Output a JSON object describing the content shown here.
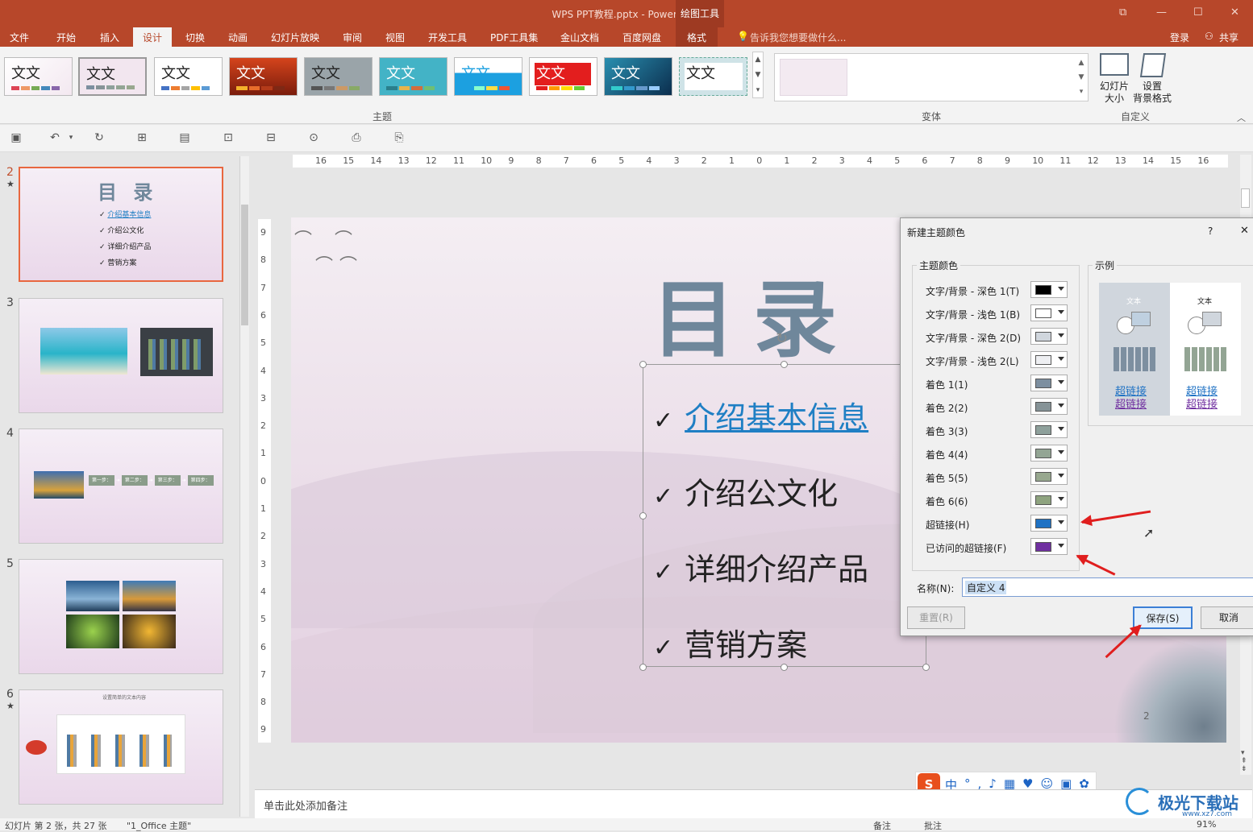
{
  "titlebar": {
    "title": "WPS PPT教程.pptx - PowerPoint",
    "context_tab": "绘图工具",
    "restore": "⧉",
    "minimize": "—",
    "maximize": "☐",
    "close": "✕"
  },
  "tabs": [
    "文件",
    "开始",
    "插入",
    "设计",
    "切换",
    "动画",
    "幻灯片放映",
    "审阅",
    "视图",
    "开发工具",
    "PDF工具集",
    "金山文档",
    "百度网盘",
    "格式"
  ],
  "tell_me": "告诉我您想要做什么...",
  "login": "登录",
  "share": "共享",
  "ribbon": {
    "theme_label": "文文",
    "group_theme": "主题",
    "group_variant": "变体",
    "group_custom": "自定义",
    "slide_size": "幻灯片\n大小",
    "bg_format": "设置\n背景格式"
  },
  "slides": [
    {
      "num": "2",
      "title": "目 录",
      "items": [
        "介绍基本信息",
        "介绍公文化",
        "详细介绍产品",
        "营销方案"
      ]
    },
    {
      "num": "3"
    },
    {
      "num": "4",
      "steps": [
        "第一步：",
        "第二步：",
        "第三步：",
        "第四步："
      ]
    },
    {
      "num": "5"
    },
    {
      "num": "6",
      "heading": "设置简单的文本内容"
    }
  ],
  "ruler_h": [
    "16",
    "15",
    "14",
    "13",
    "12",
    "11",
    "10",
    "9",
    "8",
    "7",
    "6",
    "5",
    "4",
    "3",
    "2",
    "1",
    "0",
    "1",
    "2",
    "3",
    "4",
    "5",
    "6",
    "7",
    "8",
    "9",
    "10",
    "11",
    "12",
    "13",
    "14",
    "15",
    "16"
  ],
  "ruler_v": [
    "9",
    "8",
    "7",
    "6",
    "5",
    "4",
    "3",
    "2",
    "1",
    "0",
    "1",
    "2",
    "3",
    "4",
    "5",
    "6",
    "7",
    "8",
    "9"
  ],
  "slide": {
    "title": "目录",
    "items": [
      "介绍基本信息",
      "介绍公文化",
      "详细介绍产品",
      "营销方案"
    ],
    "check": "✓",
    "page_num": "2"
  },
  "notes": "单击此处添加备注",
  "status": {
    "slide_info": "幻灯片 第 2 张，共 27 张",
    "theme": "\"1_Office 主题\"",
    "notes": "备注",
    "comments": "批注",
    "zoom": "91%"
  },
  "dialog": {
    "title": "新建主题颜色",
    "help": "?",
    "close": "✕",
    "group_colors": "主题颜色",
    "group_sample": "示例",
    "rows": [
      {
        "label": "文字/背景 - 深色 1(T)",
        "color": "#000000"
      },
      {
        "label": "文字/背景 - 浅色 1(B)",
        "color": "#ffffff"
      },
      {
        "label": "文字/背景 - 深色 2(D)",
        "color": "#d0d6dd"
      },
      {
        "label": "文字/背景 - 浅色 2(L)",
        "color": "#eeeff2"
      },
      {
        "label": "着色 1(1)",
        "color": "#7d8fa0"
      },
      {
        "label": "着色 2(2)",
        "color": "#869397"
      },
      {
        "label": "着色 3(3)",
        "color": "#8ea09b"
      },
      {
        "label": "着色 4(4)",
        "color": "#93a594"
      },
      {
        "label": "着色 5(5)",
        "color": "#98a88f"
      },
      {
        "label": "着色 6(6)",
        "color": "#8ea37f"
      },
      {
        "label": "超链接(H)",
        "color": "#1f72c4"
      },
      {
        "label": "已访问的超链接(F)",
        "color": "#7030a0"
      }
    ],
    "sample_text": "文本",
    "sample_link": "超链接",
    "sample_visited": "超链接",
    "name_label": "名称(N):",
    "name_value": "自定义 4",
    "reset": "重置(R)",
    "save": "保存(S)",
    "cancel": "取消"
  },
  "ime_label": "中",
  "watermark": "极光下载站",
  "watermark_url": "www.xz7.com"
}
